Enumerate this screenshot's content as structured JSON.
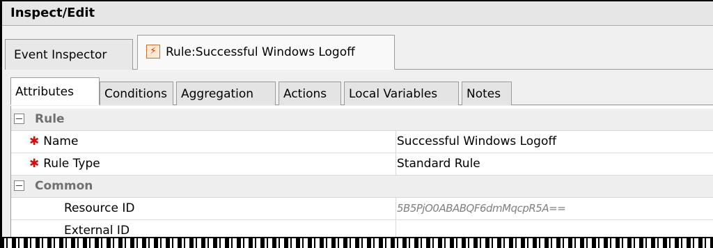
{
  "panel": {
    "title": "Inspect/Edit"
  },
  "top_tabs": [
    {
      "label": "Event Inspector",
      "active": false
    },
    {
      "label": "Rule:Successful Windows Logoff",
      "active": true,
      "icon": "rule-icon"
    }
  ],
  "sub_tabs": [
    {
      "label": "Attributes",
      "active": true
    },
    {
      "label": "Conditions",
      "active": false
    },
    {
      "label": "Aggregation",
      "active": false
    },
    {
      "label": "Actions",
      "active": false
    },
    {
      "label": "Local Variables",
      "active": false
    },
    {
      "label": "Notes",
      "active": false
    }
  ],
  "groups": {
    "rule": {
      "label": "Rule",
      "fields": {
        "name": {
          "label": "Name",
          "value": "Successful Windows Logoff",
          "required": true
        },
        "rule_type": {
          "label": "Rule Type",
          "value": "Standard Rule",
          "required": true
        }
      }
    },
    "common": {
      "label": "Common",
      "fields": {
        "resource_id": {
          "label": "Resource ID",
          "value": "5B5PjO0ABABQF6dmMqcpR5A=="
        },
        "external_id": {
          "label": "External ID",
          "value": ""
        }
      }
    }
  },
  "required_marker": "✱",
  "colors": {
    "required": "#cc1010",
    "group_text": "#707070"
  }
}
